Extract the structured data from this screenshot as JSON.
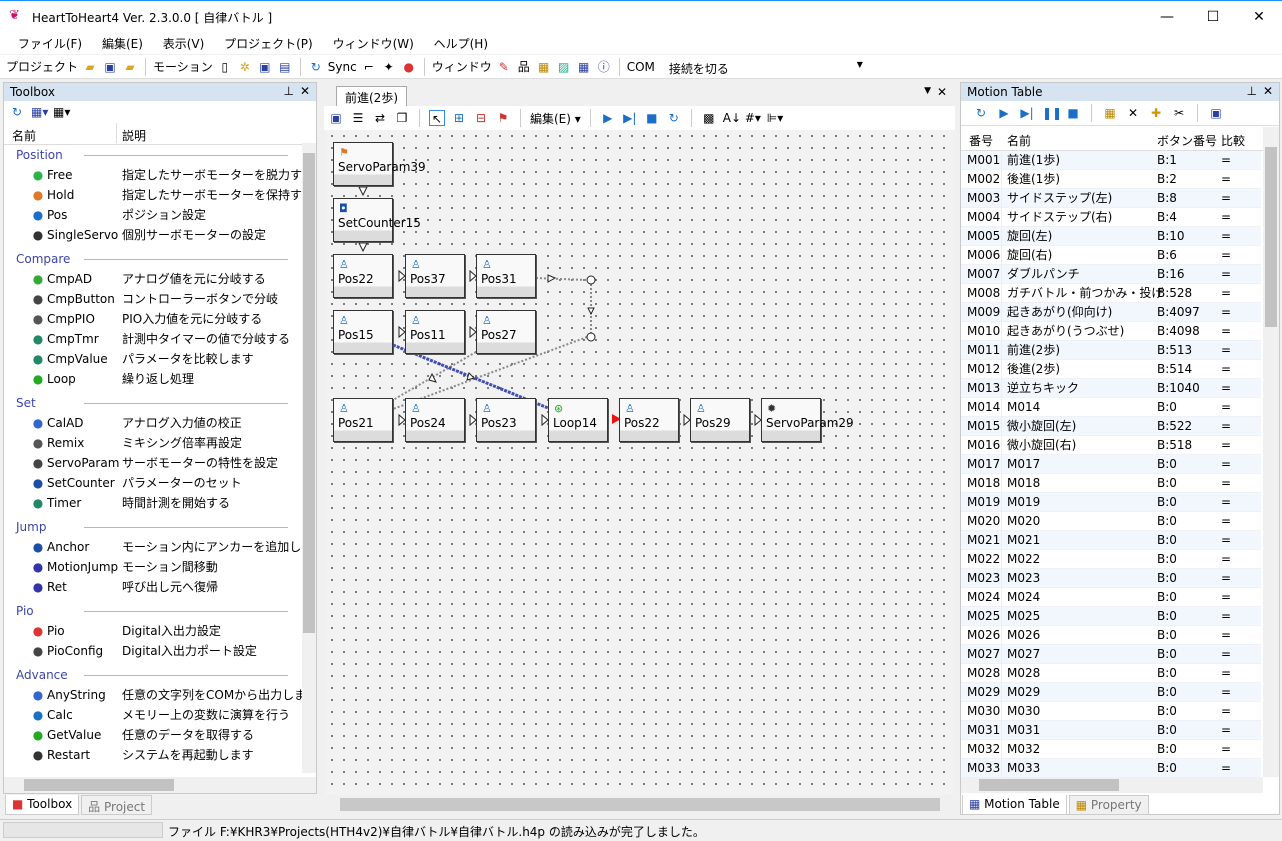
{
  "window": {
    "title": "HeartToHeart4 Ver. 2.3.0.0 [ 自律バトル ]",
    "minimize": "—",
    "maximize": "☐",
    "close": "✕"
  },
  "menu": [
    "ファイル(F)",
    "編集(E)",
    "表示(V)",
    "プロジェクト(P)",
    "ウィンドウ(W)",
    "ヘルプ(H)"
  ],
  "toolbar": {
    "project_label": "プロジェクト",
    "motion_label": "モーション",
    "sync_label": "Sync",
    "window_label": "ウィンドウ",
    "com_label": "COM",
    "com_value": "接続を切る"
  },
  "toolbox": {
    "title": "Toolbox",
    "col_name": "名前",
    "col_desc": "説明",
    "categories": [
      {
        "name": "Position",
        "items": [
          [
            "Free",
            "指定したサーボモーターを脱力する",
            "#2db24a"
          ],
          [
            "Hold",
            "指定したサーボモーターを保持する",
            "#e0782a"
          ],
          [
            "Pos",
            "ポジション設定",
            "#1b6fc7"
          ],
          [
            "SingleServo",
            "個別サーボモーターの設定",
            "#333"
          ]
        ]
      },
      {
        "name": "Compare",
        "items": [
          [
            "CmpAD",
            "アナログ値を元に分岐する",
            "#3a3"
          ],
          [
            "CmpButton",
            "コントローラーボタンで分岐",
            "#444"
          ],
          [
            "CmpPIO",
            "PIO入力値を元に分岐する",
            "#555"
          ],
          [
            "CmpTmr",
            "計測中タイマーの値で分岐する",
            "#286"
          ],
          [
            "CmpValue",
            "パラメータを比較します",
            "#286"
          ],
          [
            "Loop",
            "繰り返し処理",
            "#2a2"
          ]
        ]
      },
      {
        "name": "Set",
        "items": [
          [
            "CalAD",
            "アナログ入力値の校正",
            "#36c"
          ],
          [
            "Remix",
            "ミキシング倍率再設定",
            "#555"
          ],
          [
            "ServoParam",
            "サーボモーターの特性を設定",
            "#444"
          ],
          [
            "SetCounter",
            "パラメーターのセット",
            "#1b4fa7"
          ],
          [
            "Timer",
            "時間計測を開始する",
            "#286"
          ]
        ]
      },
      {
        "name": "Jump",
        "items": [
          [
            "Anchor",
            "モーション内にアンカーを追加します",
            "#1b4fa7"
          ],
          [
            "MotionJump",
            "モーション間移動",
            "#33a"
          ],
          [
            "Ret",
            "呼び出し元へ復帰",
            "#33a"
          ]
        ]
      },
      {
        "name": "Pio",
        "items": [
          [
            "Pio",
            "Digital入出力設定",
            "#d33"
          ],
          [
            "PioConfig",
            "Digital入出力ポート設定",
            "#444"
          ]
        ]
      },
      {
        "name": "Advance",
        "items": [
          [
            "AnyString",
            "任意の文字列をCOMから出力します",
            "#36c"
          ],
          [
            "Calc",
            "メモリー上の変数に演算を行う",
            "#1b6fc7"
          ],
          [
            "GetValue",
            "任意のデータを取得する",
            "#2a2"
          ],
          [
            "Restart",
            "システムを再起動します",
            "#333"
          ]
        ]
      }
    ],
    "tabs": [
      "Toolbox",
      "Project"
    ]
  },
  "editor": {
    "tab": "前進(2歩)",
    "edit_menu": "編集(E)",
    "nodes": [
      [
        "ServoParam39",
        0,
        0,
        "flag"
      ],
      [
        "SetCounter15",
        0,
        1,
        "counter"
      ],
      [
        "Pos22",
        0,
        2,
        "pos"
      ],
      [
        "Pos37",
        1,
        2,
        "pos"
      ],
      [
        "Pos31",
        2,
        2,
        "pos"
      ],
      [
        "Pos15",
        0,
        3,
        "pos"
      ],
      [
        "Pos11",
        1,
        3,
        "pos"
      ],
      [
        "Pos27",
        2,
        3,
        "pos"
      ],
      [
        "Pos21",
        0,
        4,
        "pos"
      ],
      [
        "Pos24",
        1,
        4,
        "pos"
      ],
      [
        "Pos23",
        2,
        4,
        "pos"
      ],
      [
        "Loop14",
        3,
        4,
        "loop"
      ],
      [
        "Pos22",
        4,
        4,
        "pos"
      ],
      [
        "Pos29",
        5,
        4,
        "pos"
      ],
      [
        "ServoParam29",
        6,
        4,
        "servo"
      ]
    ]
  },
  "motion_table": {
    "title": "Motion Table",
    "cols": [
      "番号",
      "名前",
      "ボタン番号",
      "比較"
    ],
    "rows": [
      [
        "M001",
        "前進(1歩)",
        "B:1",
        "="
      ],
      [
        "M002",
        "後進(1歩)",
        "B:2",
        "="
      ],
      [
        "M003",
        "サイドステップ(左)",
        "B:8",
        "="
      ],
      [
        "M004",
        "サイドステップ(右)",
        "B:4",
        "="
      ],
      [
        "M005",
        "旋回(左)",
        "B:10",
        "="
      ],
      [
        "M006",
        "旋回(右)",
        "B:6",
        "="
      ],
      [
        "M007",
        "ダブルパンチ",
        "B:16",
        "="
      ],
      [
        "M008",
        "ガチバトル・前つかみ・投げ",
        "B:528",
        "="
      ],
      [
        "M009",
        "起きあがり(仰向け)",
        "B:4097",
        "="
      ],
      [
        "M010",
        "起きあがり(うつぶせ)",
        "B:4098",
        "="
      ],
      [
        "M011",
        "前進(2歩)",
        "B:513",
        "="
      ],
      [
        "M012",
        "後進(2歩)",
        "B:514",
        "="
      ],
      [
        "M013",
        "逆立ちキック",
        "B:1040",
        "="
      ],
      [
        "M014",
        "M014",
        "B:0",
        "="
      ],
      [
        "M015",
        "微小旋回(左)",
        "B:522",
        "="
      ],
      [
        "M016",
        "微小旋回(右)",
        "B:518",
        "="
      ],
      [
        "M017",
        "M017",
        "B:0",
        "="
      ],
      [
        "M018",
        "M018",
        "B:0",
        "="
      ],
      [
        "M019",
        "M019",
        "B:0",
        "="
      ],
      [
        "M020",
        "M020",
        "B:0",
        "="
      ],
      [
        "M021",
        "M021",
        "B:0",
        "="
      ],
      [
        "M022",
        "M022",
        "B:0",
        "="
      ],
      [
        "M023",
        "M023",
        "B:0",
        "="
      ],
      [
        "M024",
        "M024",
        "B:0",
        "="
      ],
      [
        "M025",
        "M025",
        "B:0",
        "="
      ],
      [
        "M026",
        "M026",
        "B:0",
        "="
      ],
      [
        "M027",
        "M027",
        "B:0",
        "="
      ],
      [
        "M028",
        "M028",
        "B:0",
        "="
      ],
      [
        "M029",
        "M029",
        "B:0",
        "="
      ],
      [
        "M030",
        "M030",
        "B:0",
        "="
      ],
      [
        "M031",
        "M031",
        "B:0",
        "="
      ],
      [
        "M032",
        "M032",
        "B:0",
        "="
      ],
      [
        "M033",
        "M033",
        "B:0",
        "="
      ]
    ],
    "tabs": [
      "Motion Table",
      "Property"
    ]
  },
  "status": {
    "message": "ファイル F:¥KHR3¥Projects(HTH4v2)¥自律バトル¥自律バトル.h4p の読み込みが完了しました。"
  }
}
